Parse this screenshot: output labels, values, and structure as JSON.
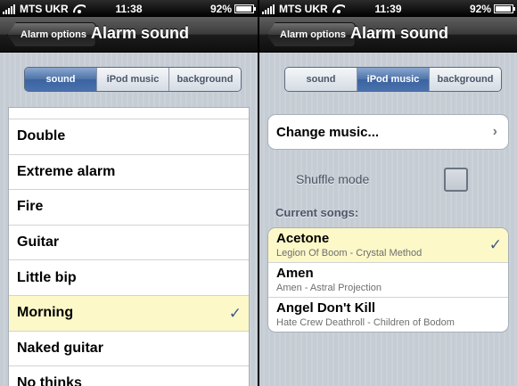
{
  "left_screen": {
    "status": {
      "carrier": "MTS UKR",
      "time": "11:38",
      "battery": "92%",
      "battery_level": 0.92
    },
    "nav": {
      "back_label": "Alarm options",
      "title": "Alarm sound"
    },
    "tabs": [
      {
        "label": "sound",
        "active": true
      },
      {
        "label": "iPod music",
        "active": false
      },
      {
        "label": "background",
        "active": false
      }
    ],
    "sounds": [
      {
        "label": ""
      },
      {
        "label": "Double"
      },
      {
        "label": "Extreme alarm"
      },
      {
        "label": "Fire"
      },
      {
        "label": "Guitar"
      },
      {
        "label": "Little bip"
      },
      {
        "label": "Morning",
        "selected": true
      },
      {
        "label": "Naked guitar"
      },
      {
        "label": "No thinks"
      }
    ],
    "checkmark": "✓"
  },
  "right_screen": {
    "status": {
      "carrier": "MTS UKR",
      "time": "11:39",
      "battery": "92%",
      "battery_level": 0.92
    },
    "nav": {
      "back_label": "Alarm options",
      "title": "Alarm sound"
    },
    "tabs": [
      {
        "label": "sound",
        "active": false
      },
      {
        "label": "iPod music",
        "active": true
      },
      {
        "label": "background",
        "active": false
      }
    ],
    "change_music_label": "Change music...",
    "shuffle_label": "Shuffle mode",
    "shuffle_on": false,
    "current_songs_label": "Current songs:",
    "songs": [
      {
        "title": "Acetone",
        "subtitle": "Legion Of Boom - Crystal Method",
        "selected": true
      },
      {
        "title": "Amen",
        "subtitle": "Amen - Astral Projection",
        "selected": false
      },
      {
        "title": "Angel Don't Kill",
        "subtitle": "Hate Crew Deathroll - Children of Bodom",
        "selected": false
      }
    ],
    "checkmark": "✓"
  }
}
